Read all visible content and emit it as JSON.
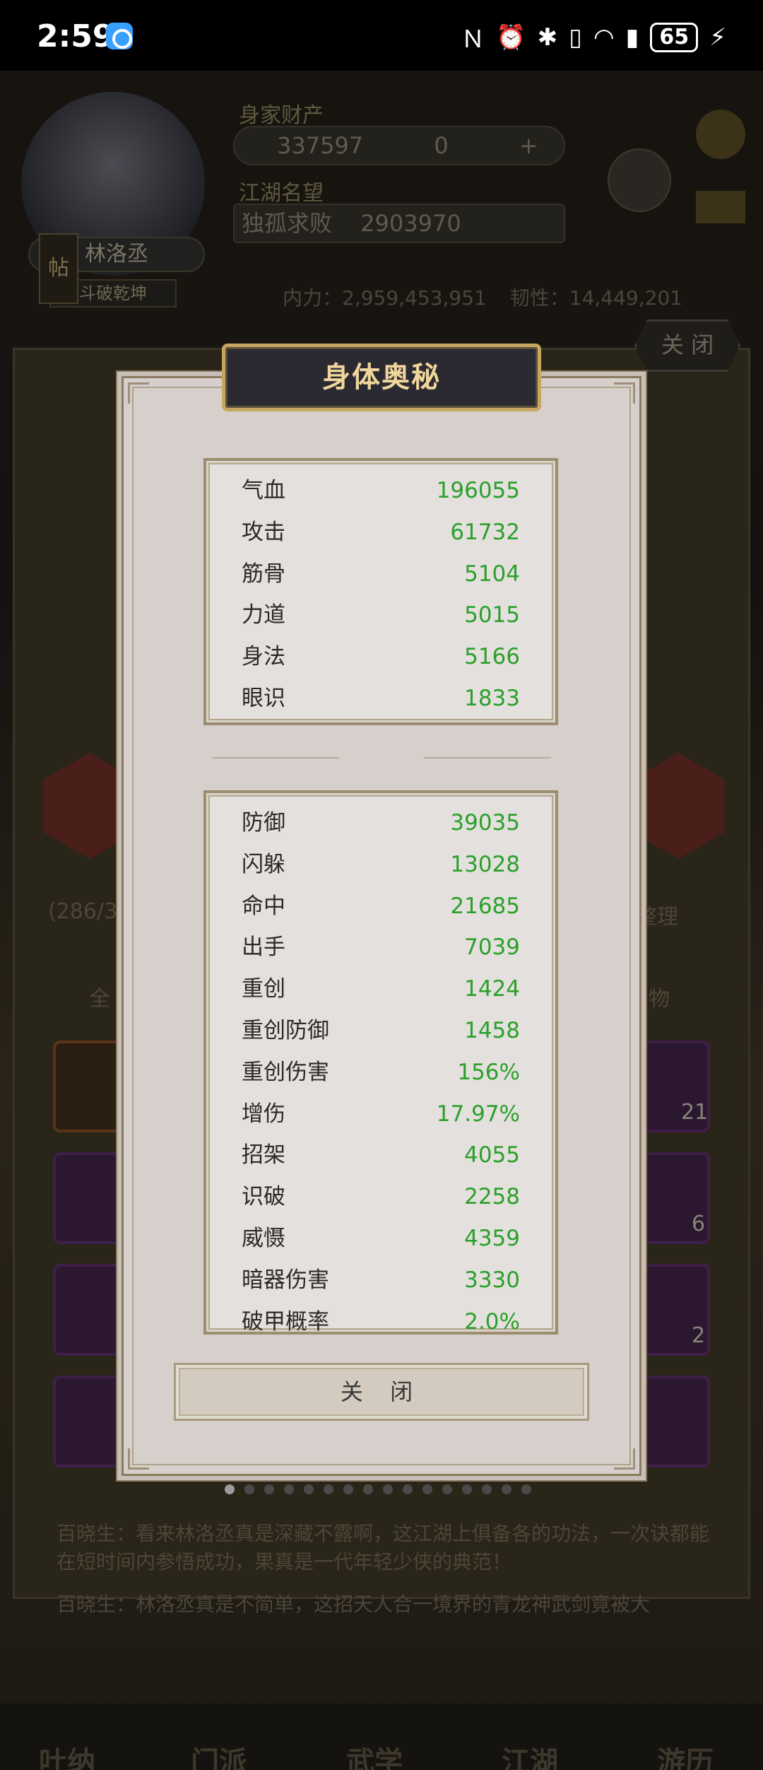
{
  "status_bar": {
    "time": "2:59",
    "battery": "65"
  },
  "background": {
    "character_name": "林洛丞",
    "character_title": "斗破乾坤",
    "wealth_label": "身家财产",
    "gold": "337597",
    "jade": "0",
    "reputation_label": "江湖名望",
    "reputation_rank": "独孤求败",
    "reputation_value": "2903970",
    "inner_power": "内力：2,959,453,951",
    "toughness": "韧性：14,449,201",
    "close_label": "关 闭",
    "tab_all": "全",
    "tab_items": "物",
    "sort_label": "整理",
    "bag_count": "(286/3",
    "post_icon": "帖",
    "chat_line_1": "百晓生：看来林洛丞真是深藏不露啊，这江湖上俱备各的功法，一次诀都能在短时间内参悟成功，果真是一代年轻少侠的典范！",
    "chat_line_2": "百晓生：林洛丞真是不简单，这招天人合一境界的青龙神武剑竟被大",
    "nav": [
      "吐纳",
      "门派",
      "武学",
      "江湖",
      "游历"
    ],
    "item_counts": [
      "21",
      "6",
      "2"
    ]
  },
  "modal": {
    "title": "身体奥秘",
    "basic_stats": [
      {
        "label": "气血",
        "value": "196055"
      },
      {
        "label": "攻击",
        "value": "61732"
      },
      {
        "label": "筋骨",
        "value": "5104"
      },
      {
        "label": "力道",
        "value": "5015"
      },
      {
        "label": "身法",
        "value": "5166"
      },
      {
        "label": "眼识",
        "value": "1833"
      }
    ],
    "advanced_stats": [
      {
        "label": "防御",
        "value": "39035"
      },
      {
        "label": "闪躲",
        "value": "13028"
      },
      {
        "label": "命中",
        "value": "21685"
      },
      {
        "label": "出手",
        "value": "7039"
      },
      {
        "label": "重创",
        "value": "1424"
      },
      {
        "label": "重创防御",
        "value": "1458"
      },
      {
        "label": "重创伤害",
        "value": "156%"
      },
      {
        "label": "增伤",
        "value": "17.97%"
      },
      {
        "label": "招架",
        "value": "4055"
      },
      {
        "label": "识破",
        "value": "2258"
      },
      {
        "label": "威慑",
        "value": "4359"
      },
      {
        "label": "暗器伤害",
        "value": "3330"
      },
      {
        "label": "破甲概率",
        "value": "2.0%"
      }
    ],
    "close_button": "关 闭"
  },
  "pagination": {
    "count": 16,
    "active": 0
  },
  "colors": {
    "value_green": "#2ba02b",
    "title_gold": "#f0d69a",
    "modal_bg": "#d6cfcb"
  }
}
